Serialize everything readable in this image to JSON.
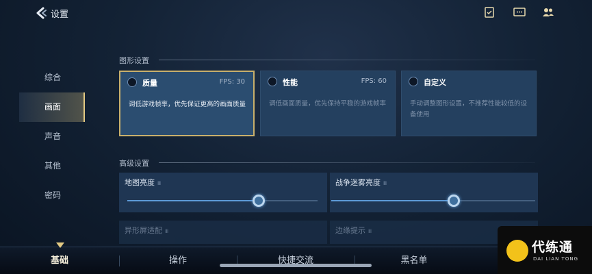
{
  "header": {
    "title": "设置",
    "icons": [
      "back-arrow-icon",
      "checklist-icon",
      "chat-icon",
      "friends-icon"
    ]
  },
  "sidebar": {
    "items": [
      {
        "label": "综合",
        "active": false
      },
      {
        "label": "画面",
        "active": true
      },
      {
        "label": "声音",
        "active": false
      },
      {
        "label": "其他",
        "active": false
      },
      {
        "label": "密码",
        "active": false
      }
    ]
  },
  "graphics": {
    "section_title": "图形设置",
    "cards": [
      {
        "name": "质量",
        "fps": "FPS: 30",
        "desc": "调低游戏帧率，优先保证更高的画面质量",
        "selected": true
      },
      {
        "name": "性能",
        "fps": "FPS: 60",
        "desc": "调低画面质量，优先保持平稳的游戏帧率",
        "selected": false
      },
      {
        "name": "自定义",
        "fps": "",
        "desc": "手动调整图形设置，不推荐性能较低的设备使用",
        "selected": false
      }
    ]
  },
  "advanced": {
    "section_title": "高级设置",
    "sliders": [
      {
        "label": "地图亮度",
        "info": "ⅲ",
        "value": 0.69
      },
      {
        "label": "战争迷雾亮度",
        "info": "ⅲ",
        "value": 0.6
      }
    ],
    "lower": [
      {
        "label": "异形屏适配",
        "info": "ⅲ"
      },
      {
        "label": "边缘提示",
        "info": "ⅲ"
      }
    ]
  },
  "bottom_tabs": [
    {
      "label": "基础",
      "active": true
    },
    {
      "label": "操作",
      "active": false
    },
    {
      "label": "快捷交流",
      "active": false
    },
    {
      "label": "黑名单",
      "active": false
    }
  ],
  "watermark": {
    "main": "代练通",
    "sub": "DAI LIAN TONG"
  },
  "colors": {
    "accent_gold": "#c9b06c",
    "slider_blue": "#5d9ad6",
    "logo_yellow": "#f2c21a"
  }
}
